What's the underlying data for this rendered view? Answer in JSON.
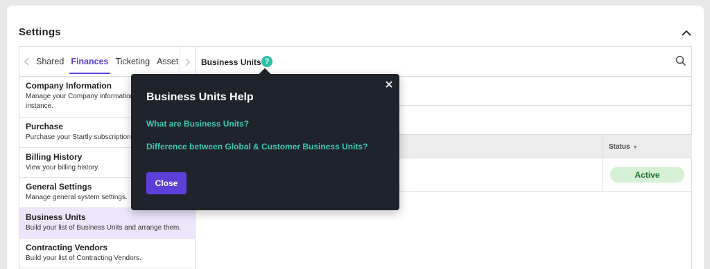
{
  "header": {
    "title": "Settings"
  },
  "tabs": {
    "items": [
      "Shared",
      "Finances",
      "Ticketing",
      "Asset"
    ],
    "active": "Finances"
  },
  "settings_list": [
    {
      "title": "Company Information",
      "desc": "Manage your Company information",
      "desc2": "instance."
    },
    {
      "title": "Purchase",
      "desc": "Purchase your Startly subscription"
    },
    {
      "title": "Billing History",
      "desc": "View your billing history."
    },
    {
      "title": "General Settings",
      "desc": "Manage general system settings."
    },
    {
      "title": "Business Units",
      "desc": "Build your list of Business Units and arrange them."
    },
    {
      "title": "Contracting Vendors",
      "desc": "Build your list of Contracting Vendors."
    }
  ],
  "content": {
    "title": "Business Units",
    "help_glyph": "?",
    "status_header": "Status",
    "status_value": "Active"
  },
  "help_popover": {
    "title": "Business Units Help",
    "link1": "What are Business Units?",
    "link2": "Difference between Global & Customer Business Units?",
    "close_label": "Close"
  },
  "colors": {
    "accent": "#5b3fd8",
    "help_teal": "#2fbfa8",
    "popover_bg": "#1f242c",
    "active_badge_bg": "#d6f0d6"
  },
  "icons": [
    "chevron-up-icon",
    "chevron-left-icon",
    "chevron-right-icon",
    "search-icon",
    "help-icon",
    "close-icon"
  ]
}
